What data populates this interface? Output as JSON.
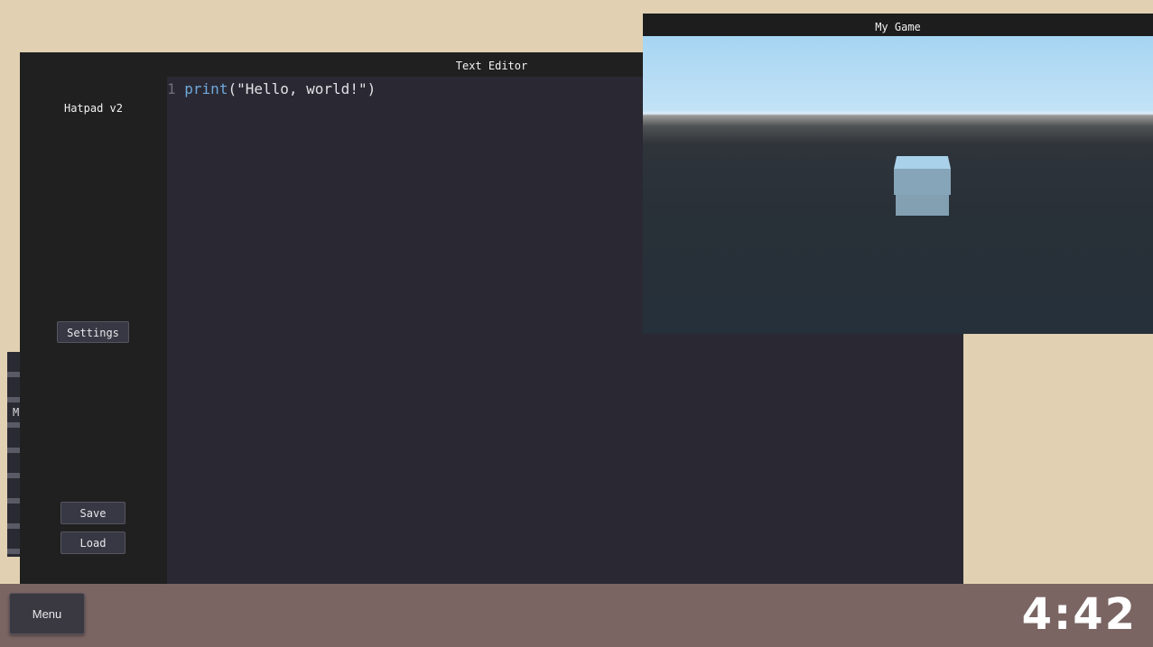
{
  "background_panel": {
    "partial_label": "M"
  },
  "editor": {
    "title": "Text Editor",
    "app_name": "Hatpad v2",
    "buttons": {
      "settings": "Settings",
      "save": "Save",
      "load": "Load"
    },
    "code": {
      "line_number": "1",
      "keyword": "print",
      "rest": "(\"Hello, world!\")"
    }
  },
  "game": {
    "title": "My Game",
    "scene": {
      "sky_color": "#a6d5f2",
      "ground_color": "#283038",
      "cube_color": "#86a5b9"
    }
  },
  "taskbar": {
    "menu_label": "Menu",
    "clock": "4:42"
  }
}
